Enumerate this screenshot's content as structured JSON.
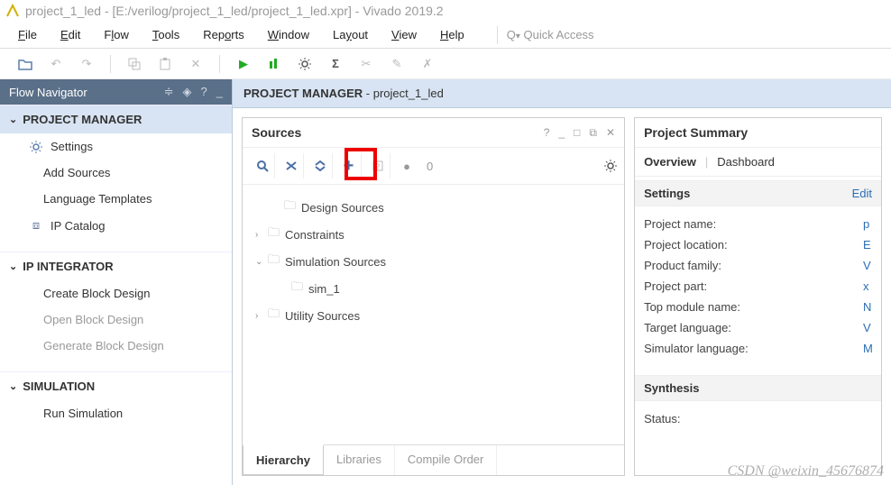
{
  "window": {
    "title": "project_1_led - [E:/verilog/project_1_led/project_1_led.xpr] - Vivado 2019.2"
  },
  "menu": {
    "file": "File",
    "edit": "Edit",
    "flow": "Flow",
    "tools": "Tools",
    "reports": "Reports",
    "window": "Window",
    "layout": "Layout",
    "view": "View",
    "help": "Help"
  },
  "quick_access_placeholder": "Quick Access",
  "flow_navigator": {
    "title": "Flow Navigator",
    "project_manager": {
      "label": "PROJECT MANAGER",
      "settings": "Settings",
      "add_sources": "Add Sources",
      "language_templates": "Language Templates",
      "ip_catalog": "IP Catalog"
    },
    "ip_integrator": {
      "label": "IP INTEGRATOR",
      "create_block_design": "Create Block Design",
      "open_block_design": "Open Block Design",
      "generate_block_design": "Generate Block Design"
    },
    "simulation": {
      "label": "SIMULATION",
      "run_simulation": "Run Simulation"
    }
  },
  "pm_header": {
    "prefix": "PROJECT MANAGER",
    "suffix": " - project_1_led"
  },
  "sources": {
    "title": "Sources",
    "count": "0",
    "tree": {
      "design_sources": "Design Sources",
      "constraints": "Constraints",
      "simulation_sources": "Simulation Sources",
      "sim_1": "sim_1",
      "utility_sources": "Utility Sources"
    },
    "tabs": {
      "hierarchy": "Hierarchy",
      "libraries": "Libraries",
      "compile_order": "Compile Order"
    }
  },
  "project_summary": {
    "title": "Project Summary",
    "overview": "Overview",
    "dashboard": "Dashboard",
    "settings_header": "Settings",
    "edit": "Edit",
    "rows": {
      "project_name": "Project name:",
      "project_location": "Project location:",
      "product_family": "Product family:",
      "project_part": "Project part:",
      "top_module_name": "Top module name:",
      "target_language": "Target language:",
      "simulator_language": "Simulator language:"
    },
    "vals": {
      "project_name": "p",
      "project_location": "E",
      "product_family": "V",
      "project_part": "x",
      "top_module_name": "N",
      "target_language": "V",
      "simulator_language": "M"
    },
    "synthesis_header": "Synthesis",
    "status_label": "Status:"
  },
  "watermark": "CSDN @weixin_45676874"
}
